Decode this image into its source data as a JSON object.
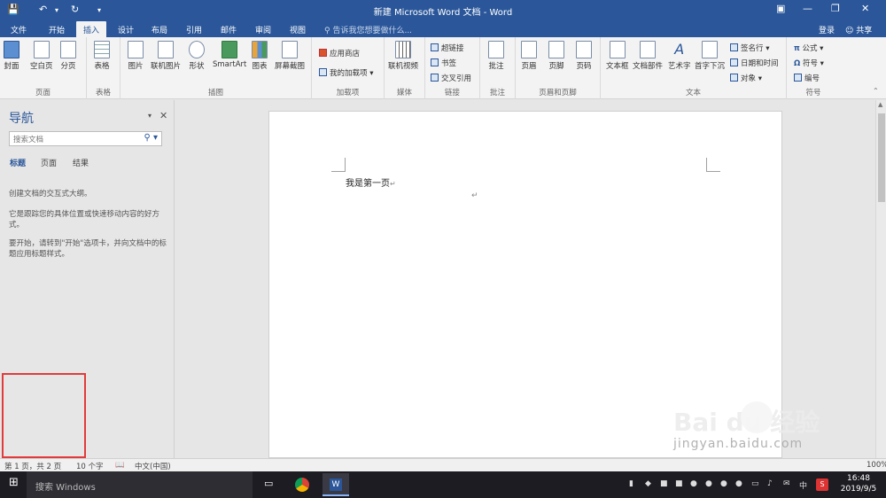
{
  "title": {
    "doc_title": "新建 Microsoft Word 文档 - Word",
    "save_icon": "save-icon",
    "undo_icon": "undo-icon",
    "redo_icon": "redo-icon"
  },
  "tabs": [
    "文件",
    "开始",
    "插入",
    "设计",
    "布局",
    "引用",
    "邮件",
    "审阅",
    "视图"
  ],
  "active_tab": "插入",
  "tell_me": "告诉我您想要做什么...",
  "account": {
    "login": "登录",
    "share": "共享"
  },
  "ribbon": {
    "pages": {
      "label": "页面",
      "buttons": [
        "封面",
        "空白页",
        "分页"
      ]
    },
    "tables": {
      "label": "表格",
      "buttons": [
        "表格"
      ]
    },
    "illustrations": {
      "label": "插图",
      "buttons": [
        "图片",
        "联机图片",
        "形状",
        "SmartArt",
        "图表",
        "屏幕截图"
      ]
    },
    "addins": {
      "label": "加载项",
      "items": [
        "应用商店",
        "我的加载项"
      ]
    },
    "media": {
      "label": "媒体",
      "buttons": [
        "联机视频"
      ]
    },
    "links": {
      "label": "链接",
      "items": [
        "超链接",
        "书签",
        "交叉引用"
      ]
    },
    "comments": {
      "label": "批注",
      "buttons": [
        "批注"
      ]
    },
    "header_footer": {
      "label": "页眉和页脚",
      "buttons": [
        "页眉",
        "页脚",
        "页码"
      ]
    },
    "text": {
      "label": "文本",
      "buttons": [
        "文本框",
        "文档部件",
        "艺术字",
        "首字下沉"
      ],
      "items": [
        "签名行",
        "日期和时间",
        "对象"
      ]
    },
    "symbols": {
      "label": "符号",
      "items": [
        "公式",
        "符号",
        "编号"
      ]
    }
  },
  "nav": {
    "title": "导航",
    "search_placeholder": "搜索文档",
    "tabs": [
      "标题",
      "页面",
      "结果"
    ],
    "text1": "创建文档的交互式大纲。",
    "text2": "它是跟踪您的具体位置或快速移动内容的好方式。",
    "text3": "要开始，请转到\"开始\"选项卡，并向文档中的标题应用标题样式。"
  },
  "document": {
    "line1": "我是第一页",
    "para_mark": "↵"
  },
  "status": {
    "page": "第 1 页，共 2 页",
    "words": "10 个字",
    "lang": "中文(中国)",
    "zoom": "100%"
  },
  "taskbar": {
    "search": "搜索 Windows",
    "time": "16:48",
    "date": "2019/9/5",
    "ime": "中"
  },
  "watermark": {
    "brand": "Bai du 经验",
    "url": "jingyan.baidu.com"
  },
  "colors": {
    "accent": "#2b579a",
    "highlight": "#e23b3b"
  }
}
